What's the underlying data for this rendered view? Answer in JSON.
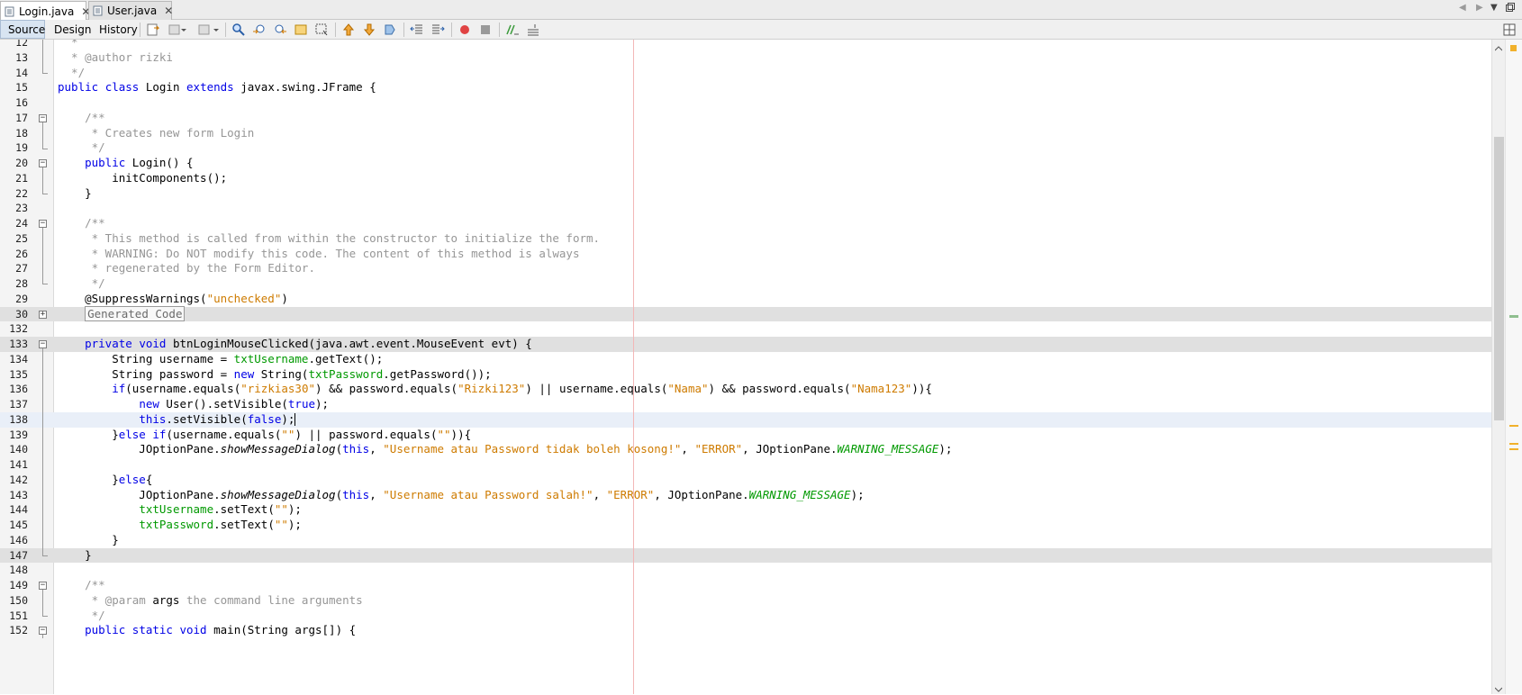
{
  "tabs": [
    {
      "label": "Login.java",
      "active": true
    },
    {
      "label": "User.java",
      "active": false
    }
  ],
  "toolbar": {
    "views": [
      "Source",
      "Design",
      "History"
    ],
    "active_view": "Source"
  },
  "colors": {
    "keyword": "#0000e6",
    "string": "#ce7b00",
    "comment": "#969696",
    "field": "#009900",
    "highlight_row": "#e0e0e0",
    "margin_line": "#f3b7b7",
    "overview_marker": "#f1b12b"
  },
  "editor": {
    "lines": [
      {
        "n": "12",
        "fold": "line",
        "tokens": [
          [
            "com",
            "  *"
          ]
        ]
      },
      {
        "n": "13",
        "fold": "line",
        "tokens": [
          [
            "com",
            "  * @author rizki"
          ]
        ]
      },
      {
        "n": "14",
        "fold": "end",
        "tokens": [
          [
            "com",
            "  */"
          ]
        ]
      },
      {
        "n": "15",
        "tokens": [
          [
            "kw",
            "public"
          ],
          [
            "",
            " "
          ],
          [
            "kw",
            "class"
          ],
          [
            "",
            " Login "
          ],
          [
            "kw",
            "extends"
          ],
          [
            "",
            " javax.swing.JFrame {"
          ]
        ]
      },
      {
        "n": "16",
        "tokens": []
      },
      {
        "n": "17",
        "fold": "minus",
        "tokens": [
          [
            "com",
            "    /**"
          ]
        ]
      },
      {
        "n": "18",
        "fold": "line",
        "tokens": [
          [
            "com",
            "     * Creates new form Login"
          ]
        ]
      },
      {
        "n": "19",
        "fold": "end",
        "tokens": [
          [
            "com",
            "     */"
          ]
        ]
      },
      {
        "n": "20",
        "fold": "minus",
        "tokens": [
          [
            "",
            "    "
          ],
          [
            "kw",
            "public"
          ],
          [
            "",
            " Login() {"
          ]
        ]
      },
      {
        "n": "21",
        "fold": "line",
        "tokens": [
          [
            "",
            "        initComponents();"
          ]
        ]
      },
      {
        "n": "22",
        "fold": "end",
        "tokens": [
          [
            "",
            "    }"
          ]
        ]
      },
      {
        "n": "23",
        "tokens": []
      },
      {
        "n": "24",
        "fold": "minus",
        "tokens": [
          [
            "com",
            "    /**"
          ]
        ]
      },
      {
        "n": "25",
        "fold": "line",
        "tokens": [
          [
            "com",
            "     * This method is called from within the constructor to initialize the form."
          ]
        ]
      },
      {
        "n": "26",
        "fold": "line",
        "tokens": [
          [
            "com",
            "     * WARNING: Do NOT modify this code. The content of this method is always"
          ]
        ]
      },
      {
        "n": "27",
        "fold": "line",
        "tokens": [
          [
            "com",
            "     * regenerated by the Form Editor."
          ]
        ]
      },
      {
        "n": "28",
        "fold": "end",
        "tokens": [
          [
            "com",
            "     */"
          ]
        ]
      },
      {
        "n": "29",
        "tokens": [
          [
            "",
            "    @SuppressWarnings("
          ],
          [
            "str",
            "\"unchecked\""
          ],
          [
            "",
            ")"
          ]
        ]
      },
      {
        "n": "30",
        "fold": "plus",
        "row": "hl",
        "tokens": [
          [
            "",
            "    "
          ],
          [
            "gen",
            "Generated Code"
          ]
        ]
      },
      {
        "n": "132",
        "tokens": []
      },
      {
        "n": "133",
        "fold": "minus",
        "row": "hl",
        "tokens": [
          [
            "",
            "    "
          ],
          [
            "kw",
            "private"
          ],
          [
            "",
            " "
          ],
          [
            "kw",
            "void"
          ],
          [
            "",
            " btnLoginMouseClicked(java.awt.event.MouseEvent evt) {"
          ]
        ]
      },
      {
        "n": "134",
        "fold": "line",
        "tokens": [
          [
            "",
            "        String username = "
          ],
          [
            "fld",
            "txtUsername"
          ],
          [
            "",
            ".getText();"
          ]
        ]
      },
      {
        "n": "135",
        "fold": "line",
        "tokens": [
          [
            "",
            "        String password = "
          ],
          [
            "kw",
            "new"
          ],
          [
            "",
            " String("
          ],
          [
            "fld",
            "txtPassword"
          ],
          [
            "",
            ".getPassword());"
          ]
        ]
      },
      {
        "n": "136",
        "fold": "line",
        "tokens": [
          [
            "",
            "        "
          ],
          [
            "kw",
            "if"
          ],
          [
            "",
            "(username.equals("
          ],
          [
            "str",
            "\"rizkias30\""
          ],
          [
            "",
            ") && password.equals("
          ],
          [
            "str",
            "\"Rizki123\""
          ],
          [
            "",
            ") || username.equals("
          ],
          [
            "str",
            "\"Nama\""
          ],
          [
            "",
            ") && password.equals("
          ],
          [
            "str",
            "\"Nama123\""
          ],
          [
            "",
            ")){"
          ]
        ]
      },
      {
        "n": "137",
        "fold": "line",
        "tokens": [
          [
            "",
            "            "
          ],
          [
            "kw",
            "new"
          ],
          [
            "",
            " User().setVisible("
          ],
          [
            "kw",
            "true"
          ],
          [
            "",
            ");"
          ]
        ]
      },
      {
        "n": "138",
        "fold": "line",
        "row": "cur",
        "tokens": [
          [
            "",
            "            "
          ],
          [
            "kw",
            "this"
          ],
          [
            "",
            ".setVisible("
          ],
          [
            "kw",
            "false"
          ],
          [
            "",
            ");"
          ],
          [
            "caret",
            ""
          ]
        ]
      },
      {
        "n": "139",
        "fold": "line",
        "tokens": [
          [
            "",
            "        }"
          ],
          [
            "kw",
            "else"
          ],
          [
            "",
            " "
          ],
          [
            "kw",
            "if"
          ],
          [
            "",
            "(username.equals("
          ],
          [
            "str",
            "\"\""
          ],
          [
            "",
            ") || password.equals("
          ],
          [
            "str",
            "\"\""
          ],
          [
            "",
            ")){"
          ]
        ]
      },
      {
        "n": "140",
        "fold": "line",
        "tokens": [
          [
            "",
            "            JOptionPane."
          ],
          [
            "ital",
            "showMessageDialog"
          ],
          [
            "",
            "("
          ],
          [
            "kw",
            "this"
          ],
          [
            "",
            ", "
          ],
          [
            "str",
            "\"Username atau Password tidak boleh kosong!\""
          ],
          [
            "",
            ", "
          ],
          [
            "str",
            "\"ERROR\""
          ],
          [
            "",
            ", JOptionPane."
          ],
          [
            "ifld",
            "WARNING_MESSAGE"
          ],
          [
            "",
            ");"
          ]
        ]
      },
      {
        "n": "141",
        "fold": "line",
        "tokens": []
      },
      {
        "n": "142",
        "fold": "line",
        "tokens": [
          [
            "",
            "        }"
          ],
          [
            "kw",
            "else"
          ],
          [
            "",
            "{"
          ]
        ]
      },
      {
        "n": "143",
        "fold": "line",
        "tokens": [
          [
            "",
            "            JOptionPane."
          ],
          [
            "ital",
            "showMessageDialog"
          ],
          [
            "",
            "("
          ],
          [
            "kw",
            "this"
          ],
          [
            "",
            ", "
          ],
          [
            "str",
            "\"Username atau Password salah!\""
          ],
          [
            "",
            ", "
          ],
          [
            "str",
            "\"ERROR\""
          ],
          [
            "",
            ", JOptionPane."
          ],
          [
            "ifld",
            "WARNING_MESSAGE"
          ],
          [
            "",
            ");"
          ]
        ]
      },
      {
        "n": "144",
        "fold": "line",
        "tokens": [
          [
            "",
            "            "
          ],
          [
            "fld",
            "txtUsername"
          ],
          [
            "",
            ".setText("
          ],
          [
            "str",
            "\"\""
          ],
          [
            "",
            ");"
          ]
        ]
      },
      {
        "n": "145",
        "fold": "line",
        "tokens": [
          [
            "",
            "            "
          ],
          [
            "fld",
            "txtPassword"
          ],
          [
            "",
            ".setText("
          ],
          [
            "str",
            "\"\""
          ],
          [
            "",
            ");"
          ]
        ]
      },
      {
        "n": "146",
        "fold": "line",
        "tokens": [
          [
            "",
            "        }"
          ]
        ]
      },
      {
        "n": "147",
        "fold": "end",
        "row": "hl",
        "tokens": [
          [
            "",
            "    }"
          ]
        ]
      },
      {
        "n": "148",
        "tokens": []
      },
      {
        "n": "149",
        "fold": "minus",
        "tokens": [
          [
            "com",
            "    /**"
          ]
        ]
      },
      {
        "n": "150",
        "fold": "line",
        "tokens": [
          [
            "com",
            "     * @param "
          ],
          [
            "",
            "args"
          ],
          [
            "com",
            " the command line arguments"
          ]
        ]
      },
      {
        "n": "151",
        "fold": "end",
        "tokens": [
          [
            "com",
            "     */"
          ]
        ]
      },
      {
        "n": "152",
        "fold": "minus",
        "tokens": [
          [
            "",
            "    "
          ],
          [
            "kw",
            "public"
          ],
          [
            "",
            " "
          ],
          [
            "kw",
            "static"
          ],
          [
            "",
            " "
          ],
          [
            "kw",
            "void"
          ],
          [
            "",
            " main(String args[]) {"
          ]
        ]
      }
    ]
  }
}
